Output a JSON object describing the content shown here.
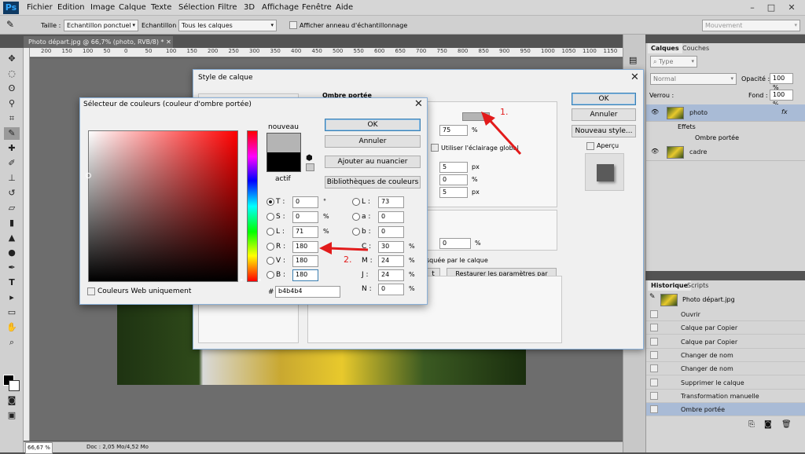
{
  "app": {
    "logo": "Ps",
    "menu": [
      "Fichier",
      "Edition",
      "Image",
      "Calque",
      "Texte",
      "Sélection",
      "Filtre",
      "3D",
      "Affichage",
      "Fenêtre",
      "Aide"
    ],
    "window_controls": {
      "minimize": "–",
      "maximize": "□",
      "close": "✕"
    }
  },
  "options": {
    "taille_label": "Taille :",
    "taille_value": "Echantillon ponctuel",
    "echantillon_label": "Echantillon :",
    "echantillon_value": "Tous les calques",
    "ring_label": "Afficher anneau d'échantillonnage",
    "workspace": "Mouvement"
  },
  "document": {
    "tab": "Photo départ.jpg @ 66,7% (photo, RVB/8) *",
    "close": "✕",
    "zoom": "66,67 %",
    "doc_size": "Doc : 2,05 Mo/4,52 Mo"
  },
  "ruler_ticks": [
    "200",
    "150",
    "100",
    "50",
    "0",
    "50",
    "100",
    "150",
    "200",
    "250",
    "300",
    "350",
    "400",
    "450",
    "500",
    "550",
    "600",
    "650",
    "700",
    "750",
    "800",
    "850",
    "900",
    "950",
    "1000",
    "1050",
    "1100",
    "1150"
  ],
  "layers_panel": {
    "tabs": [
      "Calques",
      "Couches"
    ],
    "type_filter": "Type",
    "blend": "Normal",
    "opacity_label": "Opacité :",
    "opacity": "100 %",
    "lock_label": "Verrou :",
    "fill_label": "Fond :",
    "fill": "100 %",
    "layers": [
      "photo",
      "cadre"
    ],
    "fx": "fx",
    "effects_label": "Effets",
    "effect_item": "Ombre portée"
  },
  "history_panel": {
    "tabs": [
      "Historique",
      "Scripts"
    ],
    "snapshot": "Photo départ.jpg",
    "items": [
      "Ouvrir",
      "Calque par Copier",
      "Calque par Copier",
      "Changer de nom",
      "Changer de nom",
      "Supprimer le calque",
      "Transformation manuelle",
      "Ombre portée"
    ]
  },
  "style_dialog": {
    "title": "Style de calque",
    "section": "Ombre portée",
    "opacity_value": "75",
    "pct": "%",
    "global_light": "Utiliser l'éclairage global",
    "v1": "5",
    "v2": "0",
    "v3": "5",
    "px": "px",
    "noise": "0",
    "masked": "squée par le calque",
    "reset": "Restaurer les paramètres par défaut",
    "btn_t": "t",
    "ok": "OK",
    "cancel": "Annuler",
    "new_style": "Nouveau style...",
    "preview": "Aperçu"
  },
  "picker": {
    "title": "Sélecteur de couleurs (couleur d'ombre portée)",
    "close": "✕",
    "new_label": "nouveau",
    "current_label": "actif",
    "ok": "OK",
    "cancel": "Annuler",
    "add_swatch": "Ajouter au nuancier",
    "libraries": "Bibliothèques de couleurs",
    "web_only": "Couleurs Web uniquement",
    "hsb": [
      {
        "k": "T :",
        "v": "0",
        "u": "°"
      },
      {
        "k": "S :",
        "v": "0",
        "u": "%"
      },
      {
        "k": "L :",
        "v": "71",
        "u": "%"
      }
    ],
    "rgb": [
      {
        "k": "R :",
        "v": "180"
      },
      {
        "k": "V :",
        "v": "180"
      },
      {
        "k": "B :",
        "v": "180"
      }
    ],
    "lab": [
      {
        "k": "L :",
        "v": "73"
      },
      {
        "k": "a :",
        "v": "0"
      },
      {
        "k": "b :",
        "v": "0"
      }
    ],
    "cmyk": [
      {
        "k": "C :",
        "v": "30",
        "u": "%"
      },
      {
        "k": "M :",
        "v": "24",
        "u": "%"
      },
      {
        "k": "J :",
        "v": "24",
        "u": "%"
      },
      {
        "k": "N :",
        "v": "0",
        "u": "%"
      }
    ],
    "hash": "#",
    "hex": "b4b4b4",
    "new_color": "#b4b4b4",
    "current_color": "#000000"
  },
  "annotations": {
    "a1": "1.",
    "a2": "2."
  }
}
